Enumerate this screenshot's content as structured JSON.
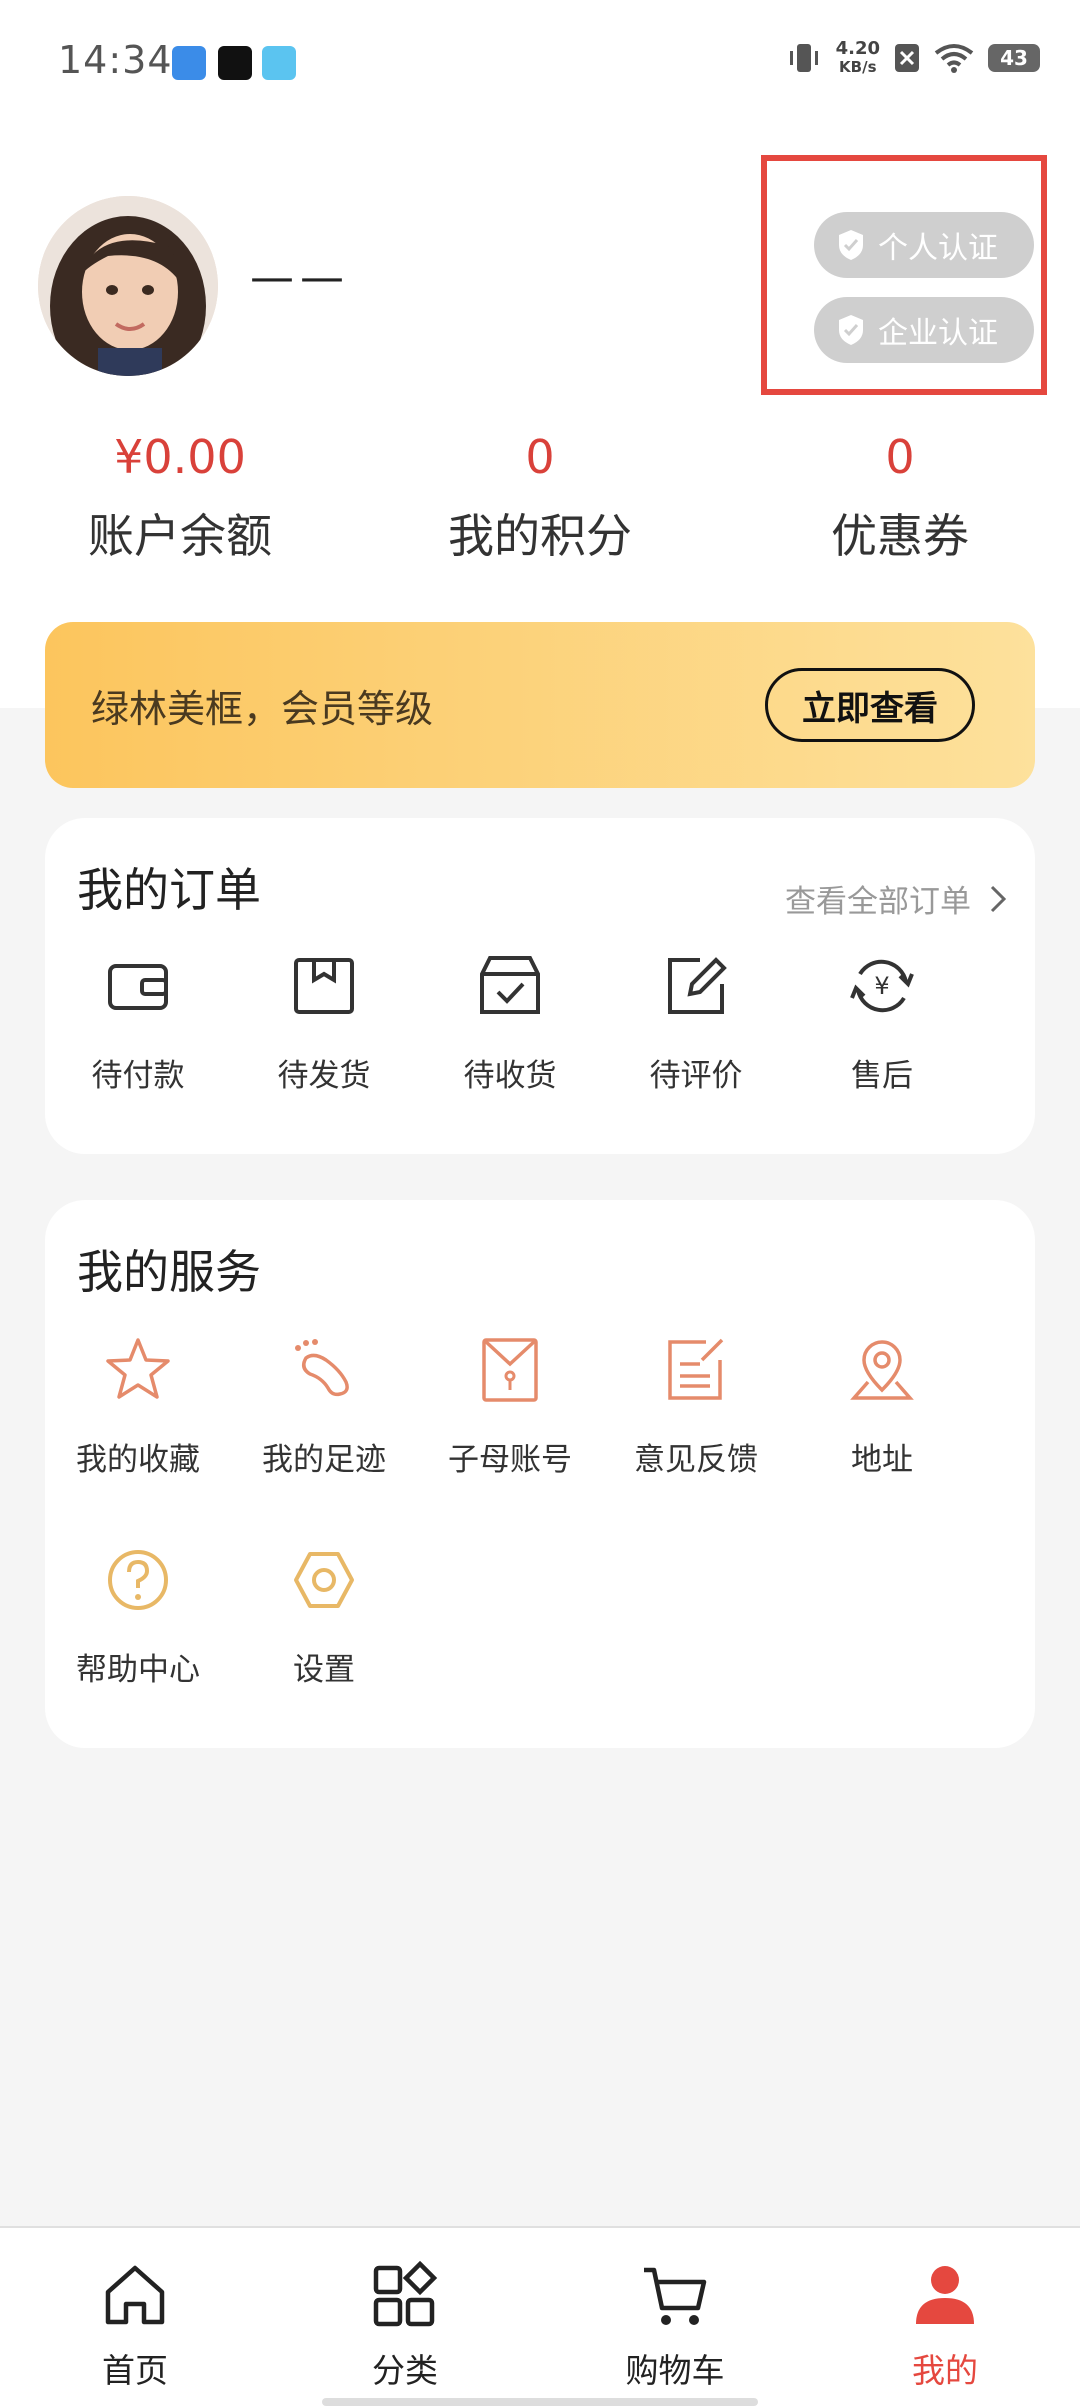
{
  "status_bar": {
    "time": "14:34",
    "speed_value": "4.20",
    "speed_unit": "KB/s",
    "battery": "43"
  },
  "profile": {
    "username": "——"
  },
  "certification": {
    "personal_label": "个人认证",
    "enterprise_label": "企业认证"
  },
  "stats": [
    {
      "value": "¥0.00",
      "label": "账户余额"
    },
    {
      "value": "0",
      "label": "我的积分"
    },
    {
      "value": "0",
      "label": "优惠券"
    }
  ],
  "banner": {
    "text": "绿林美框，会员等级",
    "button": "立即查看"
  },
  "orders": {
    "title": "我的订单",
    "view_all": "查看全部订单",
    "items": [
      {
        "label": "待付款",
        "icon": "wallet-icon"
      },
      {
        "label": "待发货",
        "icon": "box-icon"
      },
      {
        "label": "待收货",
        "icon": "package-check-icon"
      },
      {
        "label": "待评价",
        "icon": "edit-icon"
      },
      {
        "label": "售后",
        "icon": "exchange-icon"
      }
    ]
  },
  "services": {
    "title": "我的服务",
    "items": [
      {
        "label": "我的收藏",
        "icon": "star-icon"
      },
      {
        "label": "我的足迹",
        "icon": "footprint-icon"
      },
      {
        "label": "子母账号",
        "icon": "envelope-icon"
      },
      {
        "label": "意见反馈",
        "icon": "feedback-icon"
      },
      {
        "label": "地址",
        "icon": "location-icon"
      },
      {
        "label": "帮助中心",
        "icon": "help-icon"
      },
      {
        "label": "设置",
        "icon": "settings-icon"
      }
    ]
  },
  "tabbar": [
    {
      "label": "首页",
      "icon": "home-icon",
      "active": false
    },
    {
      "label": "分类",
      "icon": "category-icon",
      "active": false
    },
    {
      "label": "购物车",
      "icon": "cart-icon",
      "active": false
    },
    {
      "label": "我的",
      "icon": "user-icon",
      "active": true
    }
  ],
  "colors": {
    "accent": "#e5483f",
    "price": "#d9413a",
    "service_icon": "#e58b6b",
    "help_icon": "#e8b866",
    "banner_start": "#fcc55d",
    "banner_end": "#fde19c"
  }
}
